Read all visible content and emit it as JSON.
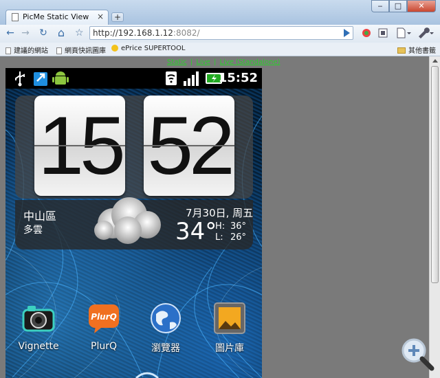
{
  "browser": {
    "tab_title": "PicMe Static View",
    "tab_close": "×",
    "new_tab": "+",
    "window_controls": {
      "minimize": "‒",
      "maximize": "□",
      "close": "✕"
    }
  },
  "toolbar": {
    "back_icon": "←",
    "forward_icon": "→",
    "reload_icon": "↻",
    "home_icon": "⌂",
    "star_icon": "☆",
    "url_host": "http://192.168.1.12",
    "url_port": ":8082/"
  },
  "bookmarks": {
    "items": [
      "建議的網站",
      "網頁快訊圖庫",
      "ePrice SUPERTOOL"
    ],
    "other": "其他書籤"
  },
  "links": {
    "static": "Static",
    "live": "Live",
    "live_standalone": "Live (Standalone)",
    "separator": "|"
  },
  "phone": {
    "status_time": "15:52",
    "clock_hour": "15",
    "clock_minute": "52",
    "location": "中山區",
    "condition": "多雲",
    "date": "7月30日, 周五",
    "temperature": "34°",
    "high_label": "H:",
    "high": "36°",
    "low_label": "L:",
    "low": "26°",
    "apps": [
      "Vignette",
      "PlurQ",
      "瀏覽器",
      "圖片庫"
    ]
  },
  "colors": {
    "link_green": "#2bd02b",
    "page_gray": "#7a7a7a"
  }
}
